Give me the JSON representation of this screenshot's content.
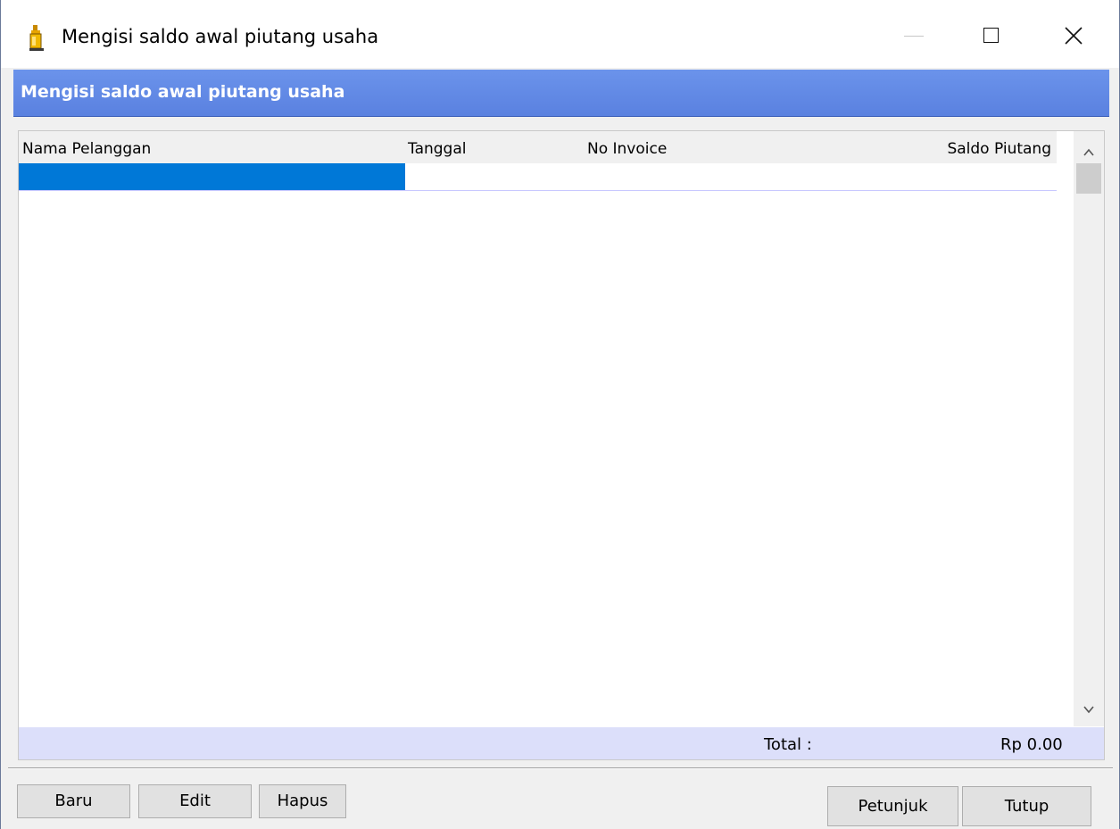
{
  "window": {
    "title": "Mengisi saldo awal piutang usaha",
    "icon": "bottle-icon",
    "controls": [
      "minimize-icon",
      "maximize-icon",
      "close-icon"
    ]
  },
  "header": {
    "title": "Mengisi saldo awal piutang usaha",
    "color": "#5f86e3"
  },
  "grid": {
    "columns": [
      "Nama Pelanggan",
      "Tanggal",
      "No Invoice",
      "Saldo Piutang"
    ],
    "rows": [],
    "selection_color": "#0078d7"
  },
  "footer": {
    "total_label": "Total :",
    "total_value": "Rp 0.00"
  },
  "buttons": {
    "baru": "Baru",
    "edit": "Edit",
    "hapus": "Hapus",
    "petunjuk": "Petunjuk",
    "tutup": "Tutup"
  }
}
